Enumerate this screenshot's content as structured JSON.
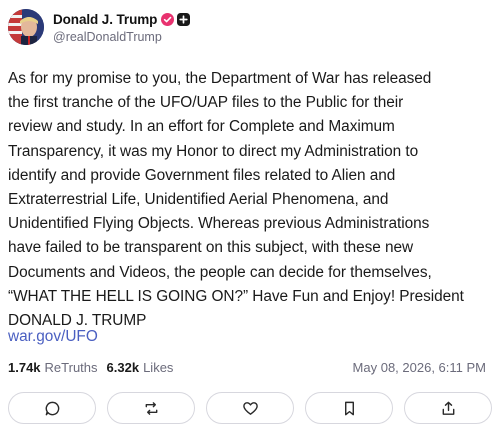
{
  "header": {
    "display_name": "Donald J. Trump",
    "handle": "@realDonaldTrump",
    "avatar_icon": "profile-avatar",
    "verified_icon": "verified-badge-icon",
    "plus_icon": "plus-badge-icon"
  },
  "post": {
    "text": "As for my promise to you, the Department of War has released\nthe first tranche of the UFO/UAP files to the Public for their\nreview and study. In an effort for Complete and Maximum\nTransparency, it was my Honor to direct my Administration to\nidentify and provide Government files related to Alien and\nExtraterrestrial Life, Unidentified Aerial Phenomena, and\nUnidentified Flying Objects. Whereas previous Administrations\nhave failed to be transparent on this subject, with these new\nDocuments and Videos, the people can decide for themselves,\n“WHAT THE HELL IS GOING ON?” Have Fun and Enjoy! President\nDONALD J. TRUMP",
    "link": "war.gov/UFO"
  },
  "stats": {
    "retruths_count": "1.74k",
    "retruths_label": "ReTruths",
    "likes_count": "6.32k",
    "likes_label": "Likes",
    "timestamp": "May 08, 2026, 6:11 PM"
  },
  "actions": [
    {
      "icon": "reply-icon"
    },
    {
      "icon": "retruth-icon"
    },
    {
      "icon": "like-icon"
    },
    {
      "icon": "bookmark-icon"
    },
    {
      "icon": "share-icon"
    }
  ],
  "colors": {
    "verified": "#e8326f",
    "link": "#4a5fc1",
    "muted": "#6b6b7b"
  }
}
